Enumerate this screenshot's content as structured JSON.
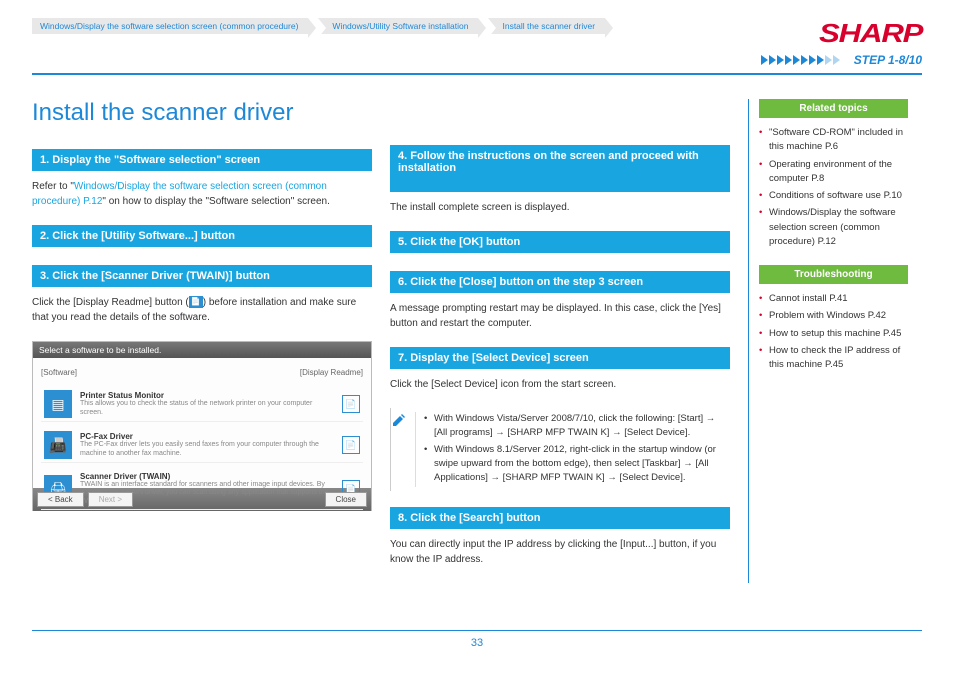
{
  "header": {
    "breadcrumbs": [
      "Windows/Display the software selection screen (common procedure)",
      "Windows/Utility Software installation",
      "Install the scanner driver"
    ],
    "logo_text": "SHARP",
    "step_label": "STEP  1-8/10",
    "progress_filled": 8,
    "progress_total": 10
  },
  "title": "Install the scanner driver",
  "left": {
    "step1": {
      "bar": "1.  Display the \"Software selection\" screen",
      "text_pre": "Refer to \"",
      "link": "Windows/Display the software selection screen (common procedure) P.12",
      "text_post": "\" on how to display the \"Software selection\" screen."
    },
    "step2": {
      "bar": "2.  Click the [Utility Software...] button"
    },
    "step3": {
      "bar": "3.  Click the [Scanner Driver (TWAIN)] button",
      "text_pre": "Click the [Display Readme] button (",
      "text_post": ") before installation and make sure that you read the details of the software."
    },
    "screenshot": {
      "title": "Select a software to be installed.",
      "top_left": "[Software]",
      "top_right": "[Display Readme]",
      "items": [
        {
          "title": "Printer Status Monitor",
          "desc": "This allows you to check the status of the network printer on your computer screen."
        },
        {
          "title": "PC-Fax Driver",
          "desc": "The PC-Fax driver lets you easily send faxes from your computer through the machine to another fax machine."
        },
        {
          "title": "Scanner Driver (TWAIN)",
          "desc": "TWAIN is an interface standard for scanners and other image input devices. By installing the TWAIN driver, you can scan using any application that supports the TWAIN standard."
        }
      ],
      "buttons": {
        "back": "< Back",
        "next": "Next >",
        "close": "Close"
      }
    }
  },
  "mid": {
    "step4": {
      "bar": "4.  Follow the instructions on the screen and proceed with installation",
      "text": "The install complete screen is displayed."
    },
    "step5": {
      "bar": "5.  Click the [OK] button"
    },
    "step6": {
      "bar": "6.  Click the [Close] button on the step 3 screen",
      "text": "A message prompting restart may be displayed. In this case, click the [Yes] button and restart the computer."
    },
    "step7": {
      "bar": "7.  Display the [Select Device] screen",
      "text": "Click the [Select Device] icon from the start screen.",
      "note1": "With Windows Vista/Server 2008/7/10, click the following: [Start] → [All programs] → [SHARP MFP TWAIN K] → [Select Device].",
      "note2": "With Windows 8.1/Server 2012, right-click in the startup window (or swipe upward from the bottom edge), then select [Taskbar] → [All Applications] → [SHARP MFP TWAIN K] → [Select Device]."
    },
    "step8": {
      "bar": "8.  Click the [Search] button",
      "text": "You can directly input the IP address by clicking the [Input...] button, if you know the IP address."
    }
  },
  "right": {
    "related_head": "Related topics",
    "related": [
      "\"Software CD-ROM\" included in this machine P.6",
      "Operating environment of the computer P.8",
      "Conditions of software use P.10",
      "Windows/Display the software selection screen (common procedure) P.12"
    ],
    "trouble_head": "Troubleshooting",
    "trouble": [
      "Cannot install P.41",
      "Problem with Windows P.42",
      "How to setup this machine P.45",
      "How to check the IP address of this machine P.45"
    ]
  },
  "page_number": "33"
}
